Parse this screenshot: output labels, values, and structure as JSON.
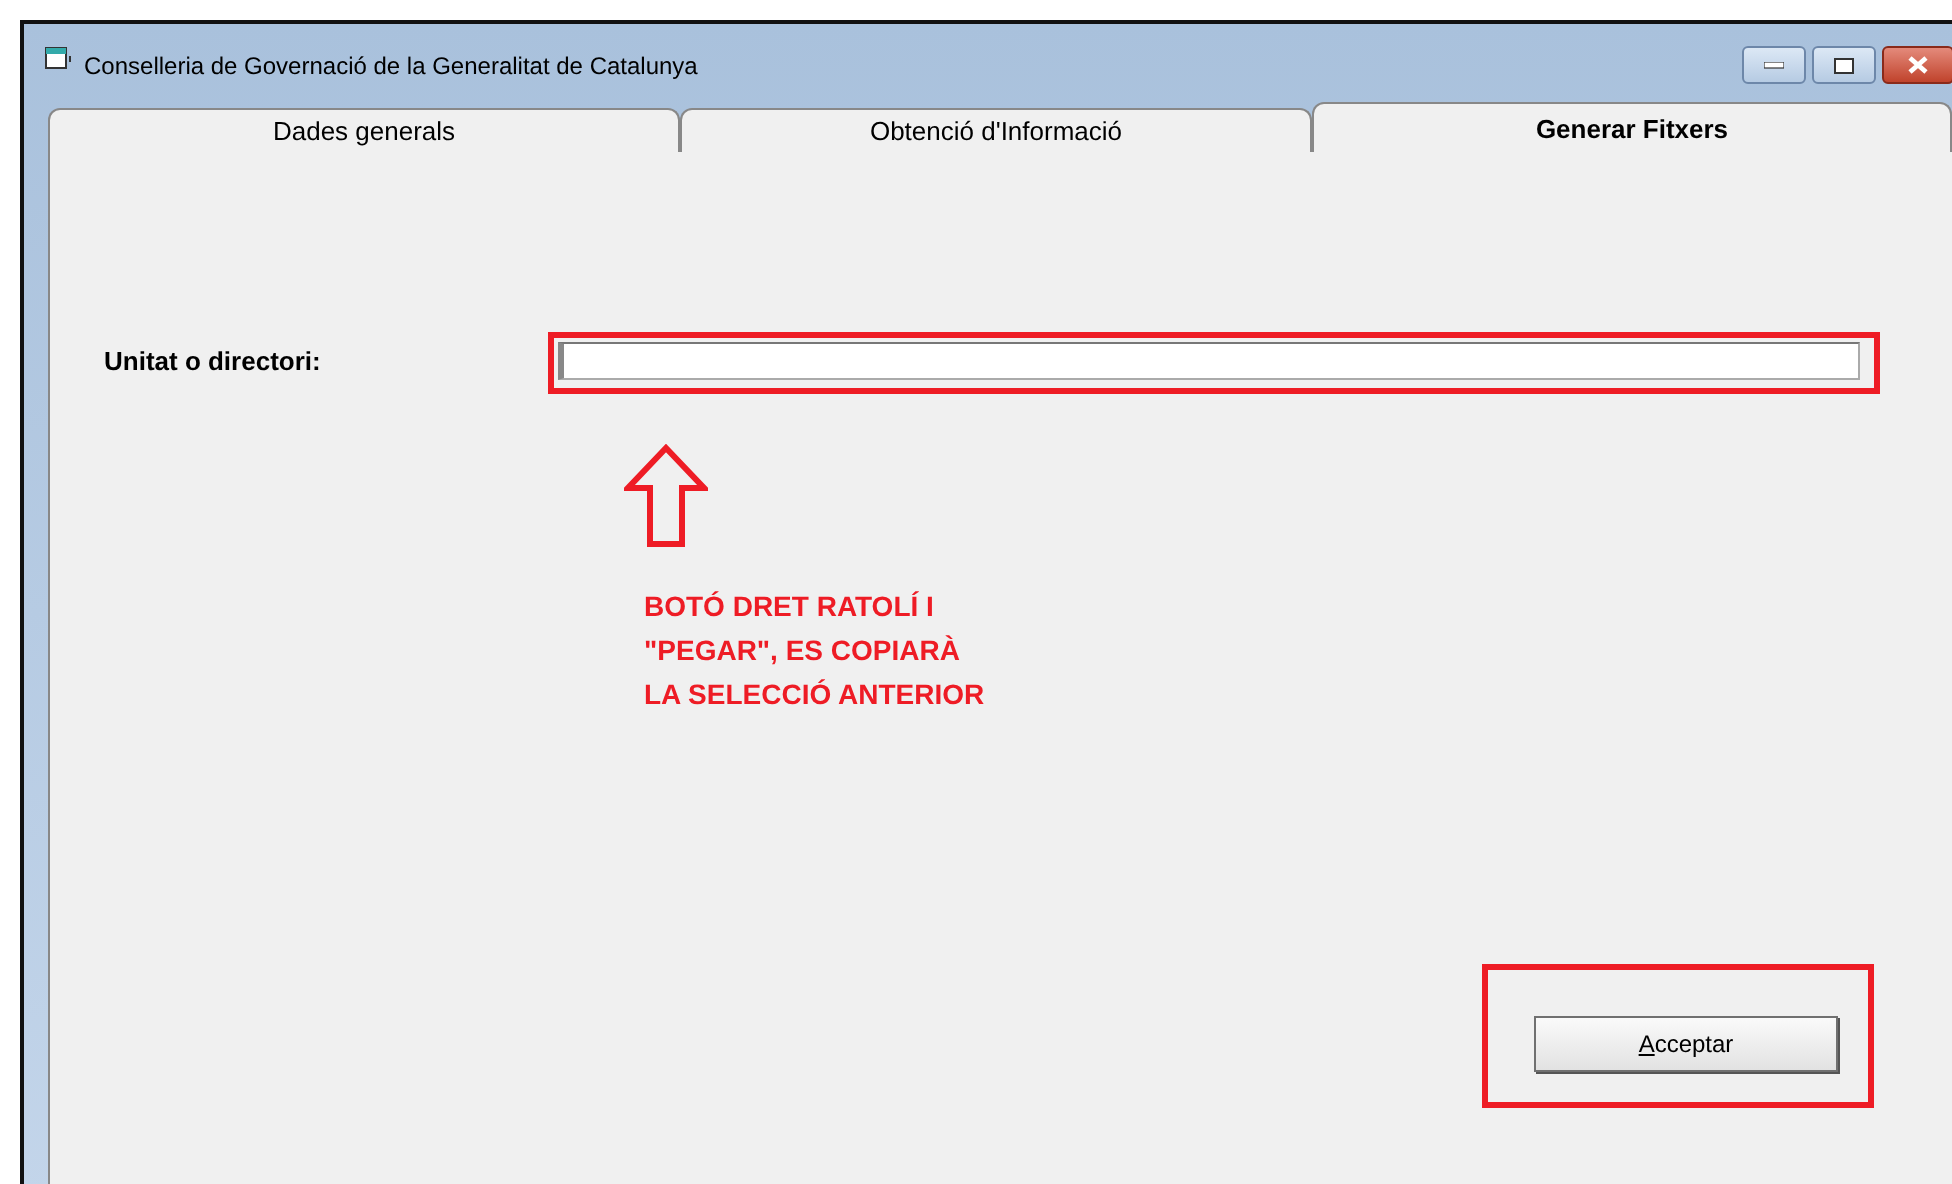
{
  "window": {
    "title": "Conselleria de Governació de la Generalitat de Catalunya"
  },
  "tabs": [
    {
      "label": "Dades generals",
      "selected": false
    },
    {
      "label": "Obtenció d'Informació",
      "selected": false
    },
    {
      "label": "Generar Fitxers",
      "selected": true
    }
  ],
  "form": {
    "field_label": "Unitat o directori:"
  },
  "annotation": {
    "lines": [
      "BOTÓ DRET RATOLÍ I",
      "\"PEGAR\", ES COPIARÀ",
      "LA SELECCIÓ ANTERIOR"
    ]
  },
  "button": {
    "label": "Acceptar",
    "access_key_underlined": true
  }
}
